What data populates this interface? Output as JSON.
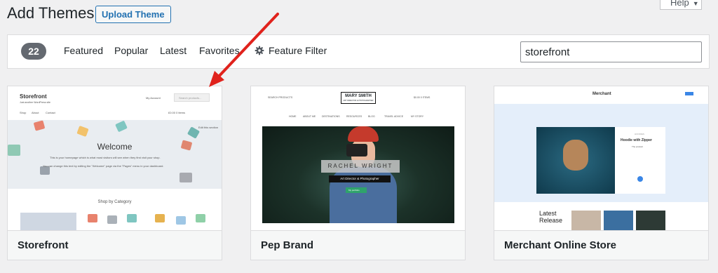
{
  "header": {
    "title": "Add Themes",
    "upload_label": "Upload Theme",
    "help_label": "Help"
  },
  "filter_bar": {
    "count": "22",
    "tabs": [
      "Featured",
      "Popular",
      "Latest",
      "Favorites"
    ],
    "feature_filter_label": "Feature Filter",
    "search_value": "storefront"
  },
  "themes": [
    {
      "name": "Storefront",
      "preview": {
        "logo": "Storefront",
        "tagline": "Just another WordPress site",
        "account": "My Account",
        "search_placeholder": "Search products...",
        "nav": [
          "Shop",
          "About",
          "Contact"
        ],
        "cart": "£0.00  0 items",
        "edit": "Edit this section",
        "welcome": "Welcome",
        "body1": "This is your homepage which is what most visitors will see when they first visit your shop.",
        "body2": "You can change this text by editing the \"Welcome\" page via the \"Pages\" menu in your dashboard.",
        "category_heading": "Shop by Category"
      }
    },
    {
      "name": "Pep Brand",
      "preview": {
        "search": "SEARCH PRODUCTS",
        "logo": "MARY SMITH",
        "logo_sub": "ART DIRECTOR & PHOTOGRAPHER",
        "cart": "$0.00  0 ITEMS",
        "nav": [
          "HOME",
          "ABOUT ME",
          "DESTINATIONS",
          "RESOURCES",
          "BLOG",
          "TRAVEL ADVICE",
          "MY STORY"
        ],
        "hero_name": "RACHEL WRIGHT",
        "hero_sub": "Art Director & Photographer",
        "hero_button": "My portfolio"
      }
    },
    {
      "name": "Merchant Online Store",
      "preview": {
        "logo": "Merchant",
        "product_label": "HOODIES",
        "product_title": "Hoodie with Zipper",
        "product_price": "The product",
        "release_label": "Latest Release"
      }
    }
  ],
  "colors": {
    "accent": "#2271b1",
    "arrow": "#e0221c",
    "badge": "#646970"
  }
}
